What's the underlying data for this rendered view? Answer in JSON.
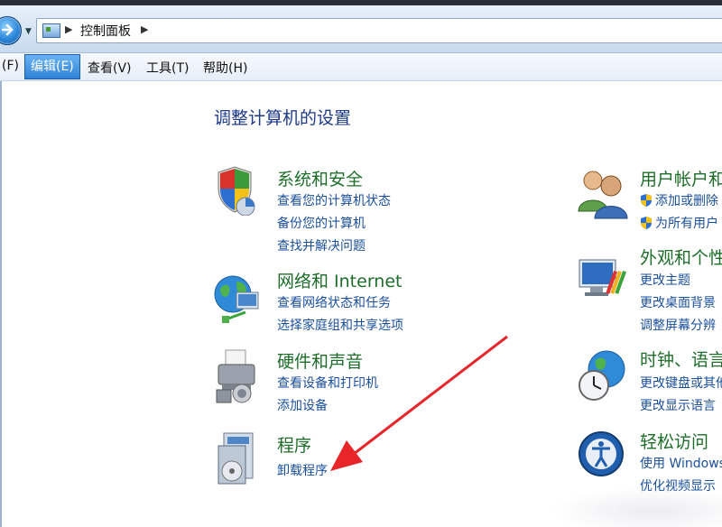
{
  "breadcrumb": {
    "root": "控制面板"
  },
  "menu": {
    "file": "(F)",
    "edit": "编辑(E)",
    "view": "查看(V)",
    "tools": "工具(T)",
    "help": "帮助(H)"
  },
  "main": {
    "heading": "调整计算机的设置",
    "categories": [
      {
        "title": "系统和安全",
        "links": [
          "查看您的计算机状态",
          "备份您的计算机",
          "查找并解决问题"
        ]
      },
      {
        "title": "网络和 Internet",
        "links": [
          "查看网络状态和任务",
          "选择家庭组和共享选项"
        ]
      },
      {
        "title": "硬件和声音",
        "links": [
          "查看设备和打印机",
          "添加设备"
        ]
      },
      {
        "title": "程序",
        "links": [
          "卸载程序"
        ]
      },
      {
        "title": "用户帐户和",
        "links": [
          "添加或删除",
          "为所有用户"
        ]
      },
      {
        "title": "外观和个性",
        "links": [
          "更改主题",
          "更改桌面背景",
          "调整屏幕分辨"
        ]
      },
      {
        "title": "时钟、语言",
        "links": [
          "更改键盘或其他",
          "更改显示语言"
        ]
      },
      {
        "title": "轻松访问",
        "links": [
          "使用 Windows",
          "优化视频显示"
        ]
      }
    ]
  },
  "colors": {
    "arrow": "#e8262a",
    "title_green": "#1e6e2a",
    "link_blue": "#1a4f9c"
  }
}
